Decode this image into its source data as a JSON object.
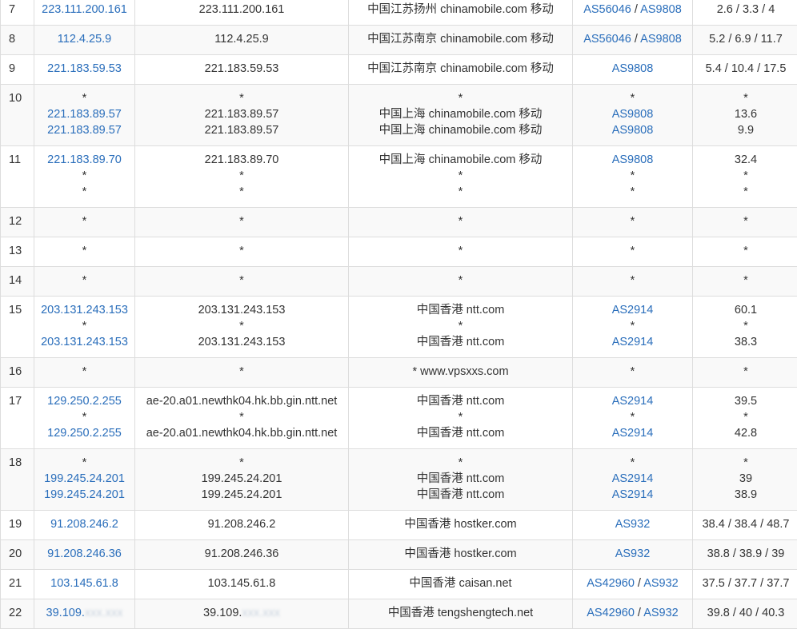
{
  "rows": [
    {
      "hop": "7",
      "odd": false,
      "h": 37,
      "lines": [
        {
          "ip": "223.111.200.161",
          "host": "223.111.200.161",
          "geo": "中国江苏扬州 chinamobile.com 移动",
          "as": [
            "AS56046",
            "AS9808"
          ],
          "rtt": "2.6 / 3.3 / 4"
        }
      ]
    },
    {
      "hop": "8",
      "odd": true,
      "h": 37,
      "lines": [
        {
          "ip": "112.4.25.9",
          "host": "112.4.25.9",
          "geo": "中国江苏南京 chinamobile.com 移动",
          "as": [
            "AS56046",
            "AS9808"
          ],
          "rtt": "5.2 / 6.9 / 11.7"
        }
      ]
    },
    {
      "hop": "9",
      "odd": false,
      "h": 37,
      "lines": [
        {
          "ip": "221.183.59.53",
          "host": "221.183.59.53",
          "geo": "中国江苏南京 chinamobile.com 移动",
          "as": [
            "AS9808"
          ],
          "rtt": "5.4 / 10.4 / 17.5"
        }
      ]
    },
    {
      "hop": "10",
      "odd": true,
      "h": 77,
      "lines": [
        {
          "ip": "*",
          "host": "*",
          "geo": "*",
          "as": [
            "*"
          ],
          "rtt": "*"
        },
        {
          "ip": "221.183.89.57",
          "host": "221.183.89.57",
          "geo": "中国上海 chinamobile.com 移动",
          "as": [
            "AS9808"
          ],
          "rtt": "13.6"
        },
        {
          "ip": "221.183.89.57",
          "host": "221.183.89.57",
          "geo": "中国上海 chinamobile.com 移动",
          "as": [
            "AS9808"
          ],
          "rtt": "9.9"
        }
      ]
    },
    {
      "hop": "11",
      "odd": false,
      "h": 77,
      "lines": [
        {
          "ip": "221.183.89.70",
          "host": "221.183.89.70",
          "geo": "中国上海 chinamobile.com 移动",
          "as": [
            "AS9808"
          ],
          "rtt": "32.4"
        },
        {
          "ip": "*",
          "host": "*",
          "geo": "*",
          "as": [
            "*"
          ],
          "rtt": "*"
        },
        {
          "ip": "*",
          "host": "*",
          "geo": "*",
          "as": [
            "*"
          ],
          "rtt": "*"
        }
      ]
    },
    {
      "hop": "12",
      "odd": true,
      "h": 37,
      "lines": [
        {
          "ip": "*",
          "host": "*",
          "geo": "*",
          "as": [
            "*"
          ],
          "rtt": "*"
        }
      ]
    },
    {
      "hop": "13",
      "odd": false,
      "h": 37,
      "lines": [
        {
          "ip": "*",
          "host": "*",
          "geo": "*",
          "as": [
            "*"
          ],
          "rtt": "*"
        }
      ]
    },
    {
      "hop": "14",
      "odd": true,
      "h": 37,
      "lines": [
        {
          "ip": "*",
          "host": "*",
          "geo": "*",
          "as": [
            "*"
          ],
          "rtt": "*"
        }
      ]
    },
    {
      "hop": "15",
      "odd": false,
      "h": 77,
      "lines": [
        {
          "ip": "203.131.243.153",
          "host": "203.131.243.153",
          "geo": "中国香港 ntt.com",
          "as": [
            "AS2914"
          ],
          "rtt": "60.1"
        },
        {
          "ip": "*",
          "host": "*",
          "geo": "*",
          "as": [
            "*"
          ],
          "rtt": "*"
        },
        {
          "ip": "203.131.243.153",
          "host": "203.131.243.153",
          "geo": "中国香港 ntt.com",
          "as": [
            "AS2914"
          ],
          "rtt": "38.3"
        }
      ]
    },
    {
      "hop": "16",
      "odd": true,
      "h": 37,
      "lines": [
        {
          "ip": "*",
          "host": "*",
          "geo": "* www.vpsxxs.com",
          "as": [
            "*"
          ],
          "rtt": "*"
        }
      ]
    },
    {
      "hop": "17",
      "odd": false,
      "h": 77,
      "lines": [
        {
          "ip": "129.250.2.255",
          "host": "ae-20.a01.newthk04.hk.bb.gin.ntt.net",
          "geo": "中国香港 ntt.com",
          "as": [
            "AS2914"
          ],
          "rtt": "39.5"
        },
        {
          "ip": "*",
          "host": "*",
          "geo": "*",
          "as": [
            "*"
          ],
          "rtt": "*"
        },
        {
          "ip": "129.250.2.255",
          "host": "ae-20.a01.newthk04.hk.bb.gin.ntt.net",
          "geo": "中国香港 ntt.com",
          "as": [
            "AS2914"
          ],
          "rtt": "42.8"
        }
      ]
    },
    {
      "hop": "18",
      "odd": true,
      "h": 77,
      "lines": [
        {
          "ip": "*",
          "host": "*",
          "geo": "*",
          "as": [
            "*"
          ],
          "rtt": "*"
        },
        {
          "ip": "199.245.24.201",
          "host": "199.245.24.201",
          "geo": "中国香港 ntt.com",
          "as": [
            "AS2914"
          ],
          "rtt": "39"
        },
        {
          "ip": "199.245.24.201",
          "host": "199.245.24.201",
          "geo": "中国香港 ntt.com",
          "as": [
            "AS2914"
          ],
          "rtt": "38.9"
        }
      ]
    },
    {
      "hop": "19",
      "odd": false,
      "h": 37,
      "lines": [
        {
          "ip": "91.208.246.2",
          "host": "91.208.246.2",
          "geo": "中国香港 hostker.com",
          "as": [
            "AS932"
          ],
          "rtt": "38.4 / 38.4 / 48.7"
        }
      ]
    },
    {
      "hop": "20",
      "odd": true,
      "h": 37,
      "lines": [
        {
          "ip": "91.208.246.36",
          "host": "91.208.246.36",
          "geo": "中国香港 hostker.com",
          "as": [
            "AS932"
          ],
          "rtt": "38.8 / 38.9 / 39"
        }
      ]
    },
    {
      "hop": "21",
      "odd": false,
      "h": 37,
      "lines": [
        {
          "ip": "103.145.61.8",
          "host": "103.145.61.8",
          "geo": "中国香港 caisan.net",
          "as": [
            "AS42960",
            "AS932"
          ],
          "rtt": "37.5 / 37.7 / 37.7"
        }
      ]
    },
    {
      "hop": "22",
      "odd": true,
      "h": 37,
      "lines": [
        {
          "ip": "39.109.",
          "ip_masked": "xxx.xxx",
          "host": "39.109.",
          "host_masked": "xxx.xxx",
          "geo": "中国香港 tengshengtech.net",
          "as": [
            "AS42960",
            "AS932"
          ],
          "rtt": "39.8 / 40 / 40.3"
        }
      ]
    }
  ],
  "colors": {
    "link": "#2a6ebb",
    "text": "#333333",
    "border": "#dddddd",
    "stripe": "#f9f9f9"
  }
}
